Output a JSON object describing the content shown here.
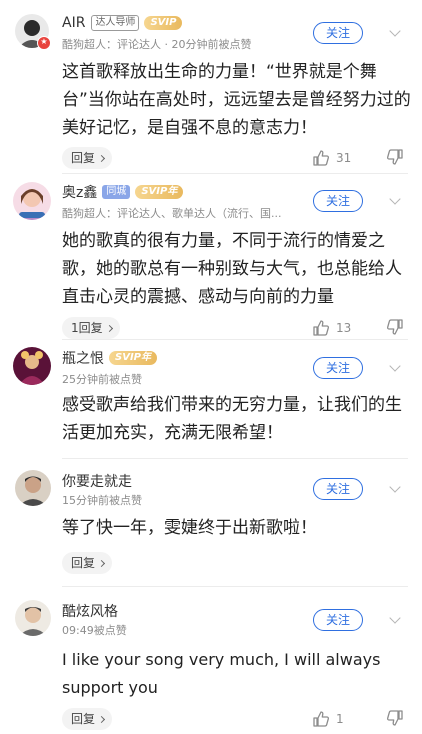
{
  "comments": [
    {
      "name": "AIR",
      "tags": [
        "达人导师",
        "SVIP"
      ],
      "subtitle": "酷狗超人：评论达人 · 20分钟前被点赞",
      "text": "这首歌释放出生命的力量！“世界就是个舞台”当你站在高处时，远远望去是曾经努力过的美好记忆，是自强不息的意志力！",
      "reply_label": "回复",
      "like_count": "31",
      "follow_label": "关注",
      "avatar_colors": [
        "#2b2b2b",
        "#7a7a7a"
      ]
    },
    {
      "name": "奥z鑫",
      "tags": [
        "同城",
        "SVIP年"
      ],
      "subtitle": "酷狗超人：评论达人、歌单达人（流行、国...",
      "text": "她的歌真的很有力量，不同于流行的情爱之歌，她的歌总有一种别致与大气，也总能给人直击心灵的震撼、感动与向前的力量",
      "reply_label": "1回复",
      "like_count": "13",
      "follow_label": "关注",
      "avatar_colors": [
        "#f1c6d6",
        "#b78ac7"
      ]
    },
    {
      "name": "瓶之恨",
      "tags": [
        "SVIP年"
      ],
      "subtitle": "25分钟前被点赞",
      "text": "感受歌声给我们带来的无穷力量，让我们的生活更加充实，充满无限希望！",
      "reply_label": "回复",
      "like_count": "",
      "follow_label": "关注",
      "avatar_colors": [
        "#7a1a4a",
        "#e0a65a"
      ]
    },
    {
      "name": "你要走就走",
      "tags": [],
      "subtitle": "15分钟前被点赞",
      "text": "等了快一年，雯婕终于出新歌啦！",
      "reply_label": "回复",
      "like_count": "",
      "follow_label": "关注",
      "avatar_colors": [
        "#d9d0c4",
        "#4a4a4a"
      ]
    },
    {
      "name": "酷炫风格",
      "tags": [],
      "subtitle": "09:49被点赞",
      "text": "I like your song very much, I will always support you",
      "reply_label": "回复",
      "like_count": "1",
      "follow_label": "关注",
      "avatar_colors": [
        "#e8e4dc",
        "#5b5b5b"
      ]
    }
  ],
  "icons": {
    "like": "thumbs-up-icon",
    "dislike": "thumbs-down-icon",
    "more": "chevron-down-icon",
    "reply_arrow": "chevron-right-icon",
    "vip_badge": "vip-star-badge-icon"
  },
  "colors": {
    "accent": "#2f6fe0",
    "svip": "#e9b95e",
    "vip_badge": "#e8433d"
  }
}
